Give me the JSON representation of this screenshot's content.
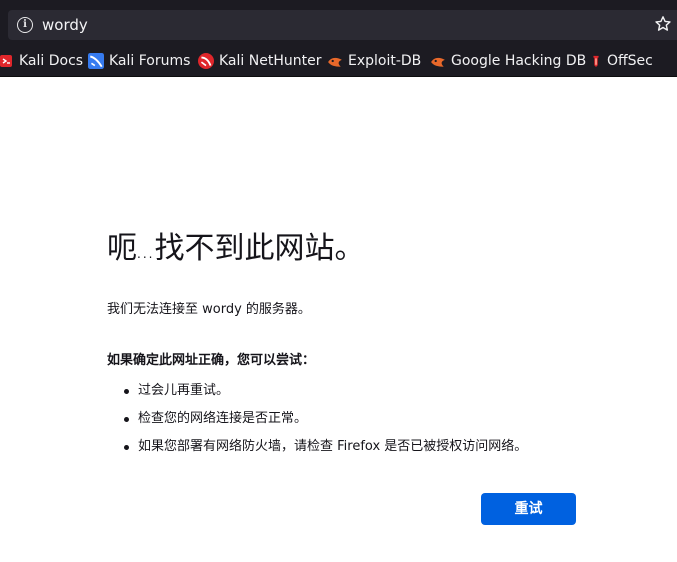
{
  "urlbar": {
    "url": "wordy",
    "info_icon": "info-icon",
    "bookmark_star_icon": "star-icon"
  },
  "bookmarks": [
    {
      "label": "Kali Docs",
      "icon": "kali-docs-icon",
      "color": "#e0262b"
    },
    {
      "label": "Kali Forums",
      "icon": "kali-forums-icon",
      "color": "#367bf0"
    },
    {
      "label": "Kali NetHunter",
      "icon": "kali-nethunter-icon",
      "color": "#e0262b"
    },
    {
      "label": "Exploit-DB",
      "icon": "exploit-db-icon",
      "color": "#e8682a"
    },
    {
      "label": "Google Hacking DB",
      "icon": "ghdb-icon",
      "color": "#e8682a"
    },
    {
      "label": "OffSec",
      "icon": "offsec-icon",
      "color": "#e0262b"
    }
  ],
  "error": {
    "title_prefix": "呃",
    "title_dots": "...",
    "title_suffix": "找不到此网站。",
    "description": "我们无法连接至 wordy 的服务器。",
    "suggest_heading": "如果确定此网址正确，您可以尝试：",
    "suggestions": [
      "过会儿再重试。",
      "检查您的网络连接是否正常。",
      "如果您部署有网络防火墙，请检查 Firefox 是否已被授权访问网络。"
    ],
    "retry_label": "重试"
  },
  "colors": {
    "chrome_bg": "#1c1b22",
    "urlbar_bg": "#2b2a33",
    "accent": "#0061e0",
    "text": "#15141a"
  }
}
